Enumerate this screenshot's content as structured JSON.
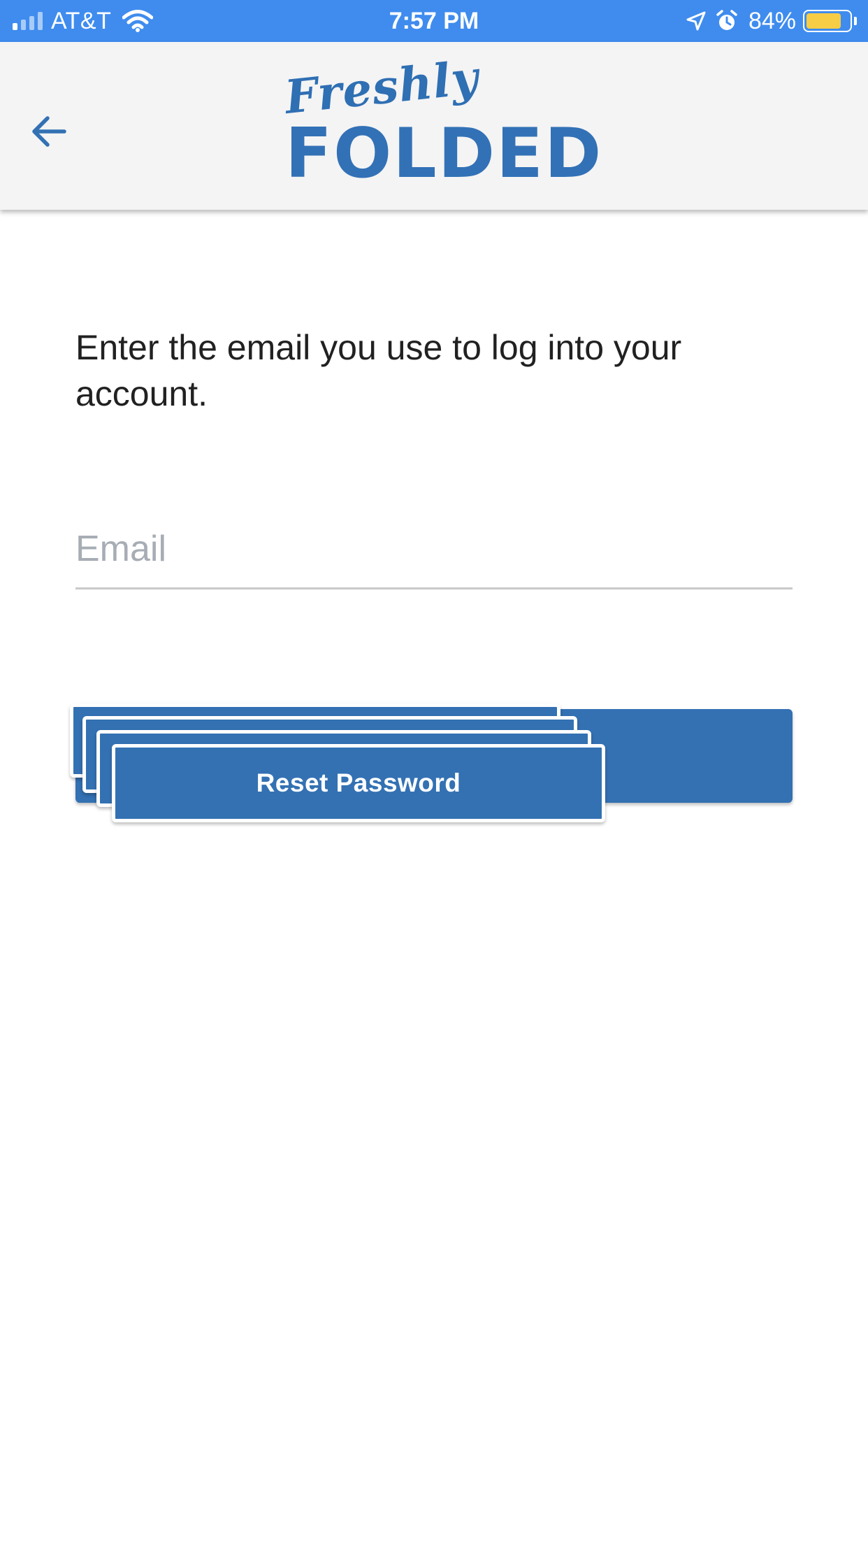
{
  "status_bar": {
    "carrier": "AT&T",
    "time": "7:57 PM",
    "battery_percent": "84%",
    "battery_level": 0.84,
    "icons": [
      "signal-icon",
      "wifi-icon",
      "location-arrow-icon",
      "alarm-icon",
      "battery-icon"
    ],
    "background_color": "#3f8cee"
  },
  "header": {
    "back_icon": "arrow-left-icon",
    "logo": {
      "script": "Freshly",
      "word": "FOLDED"
    },
    "background_color": "#f4f4f4"
  },
  "main": {
    "instructions": "Enter the email you use to log into your account.",
    "email": {
      "value": "",
      "placeholder": "Email"
    },
    "reset_button_label": "Reset Password"
  },
  "colors": {
    "accent": "#3371b3",
    "text": "#212121",
    "placeholder": "#a7adb5"
  }
}
